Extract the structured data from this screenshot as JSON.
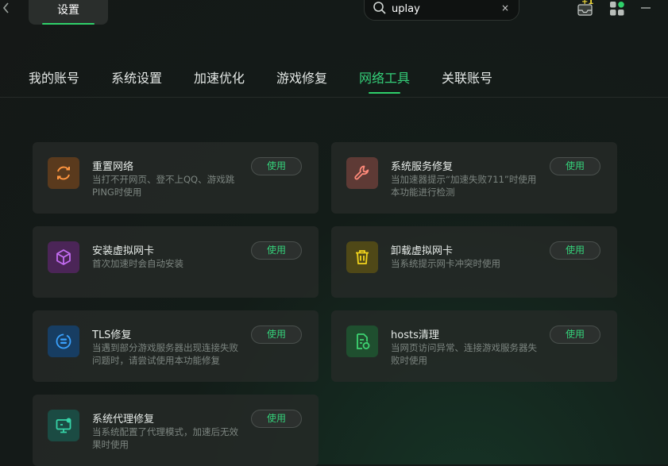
{
  "topbar": {
    "back_icon": "chevron-left-icon",
    "title_tab": "设置",
    "search": {
      "value": "uplay",
      "clear": "×"
    },
    "icons": [
      "inbox-plus-one-icon",
      "apps-grid-icon",
      "minimize-icon"
    ],
    "badge": "+1"
  },
  "nav": {
    "tabs": [
      {
        "label": "我的账号"
      },
      {
        "label": "系统设置"
      },
      {
        "label": "加速优化"
      },
      {
        "label": "游戏修复"
      },
      {
        "label": "网络工具",
        "active": true
      },
      {
        "label": "关联账号"
      }
    ]
  },
  "tools": [
    {
      "name": "重置网络",
      "desc": "当打不开网页、登不上QQ、游戏跳PING时使用",
      "button": "使用",
      "icon": "refresh-icon",
      "color": "#ff9640"
    },
    {
      "name": "系统服务修复",
      "desc": "当加速器提示“加速失败711”时使用本功能进行检测",
      "button": "使用",
      "icon": "wrench-icon",
      "color": "#ff8a7a"
    },
    {
      "name": "安装虚拟网卡",
      "desc": "首次加速时会自动安装",
      "button": "使用",
      "icon": "cube-icon",
      "color": "#c36cf2"
    },
    {
      "name": "卸载虚拟网卡",
      "desc": "当系统提示网卡冲突时使用",
      "button": "使用",
      "icon": "trash-icon",
      "color": "#f2d41c"
    },
    {
      "name": "TLS修复",
      "desc": "当遇到部分游戏服务器出现连接失败问题时，请尝试使用本功能修复",
      "button": "使用",
      "icon": "shield-list-icon",
      "color": "#3aa2ff"
    },
    {
      "name": "hosts清理",
      "desc": "当网页访问异常、连接游戏服务器失败时使用",
      "button": "使用",
      "icon": "file-refresh-icon",
      "color": "#3ed472"
    },
    {
      "name": "系统代理修复",
      "desc": "当系统配置了代理模式，加速后无效果时使用",
      "button": "使用",
      "icon": "monitor-icon",
      "color": "#36d4a8"
    }
  ]
}
